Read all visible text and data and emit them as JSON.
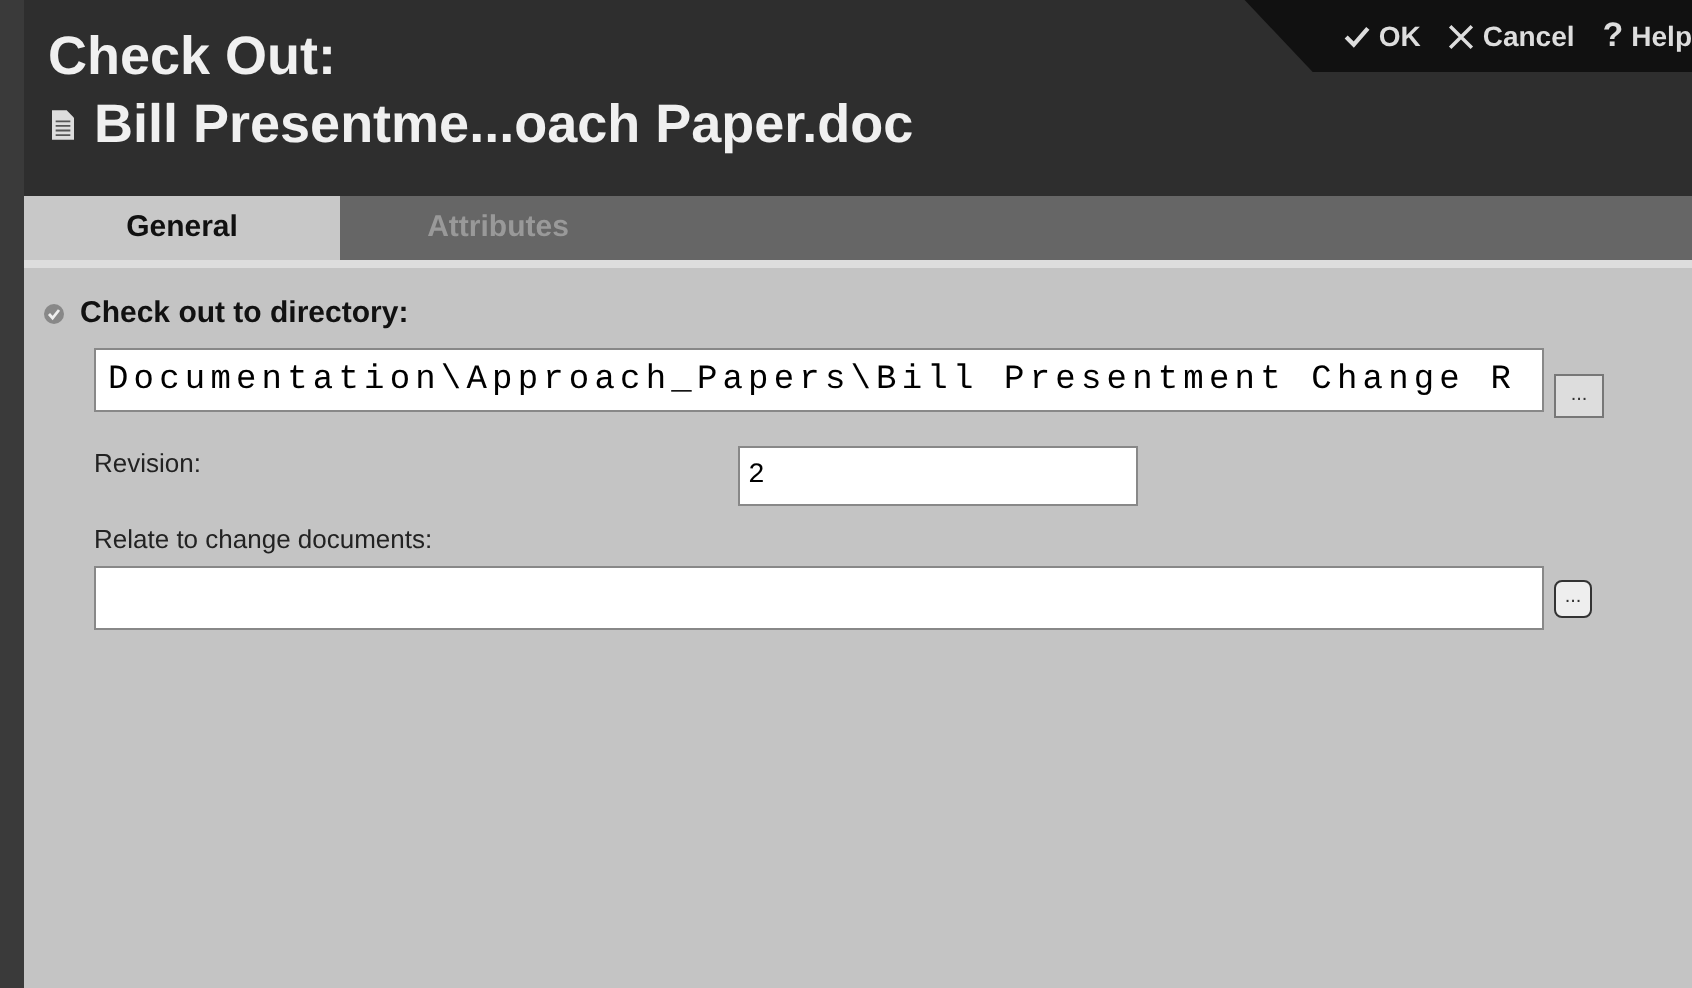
{
  "header": {
    "title": "Check Out:",
    "document": "Bill Presentme...oach Paper.doc"
  },
  "toolbar": [
    {
      "kind": "ok",
      "label": "OK"
    },
    {
      "kind": "cancel",
      "label": "Cancel"
    },
    {
      "kind": "help",
      "glyph": "?",
      "label": "Help"
    }
  ],
  "tabs": [
    {
      "label": "General",
      "selected": true
    },
    {
      "label": "Attributes",
      "selected": false
    }
  ],
  "form": {
    "directory": {
      "label": "Check out to directory:",
      "required": true,
      "value": "Documentation\\Approach_Papers\\Bill Presentment Change R",
      "browse": "..."
    },
    "revision": {
      "label": "Revision:",
      "value": "2"
    },
    "relate": {
      "label": "Relate to change documents:",
      "browse": "..."
    }
  }
}
